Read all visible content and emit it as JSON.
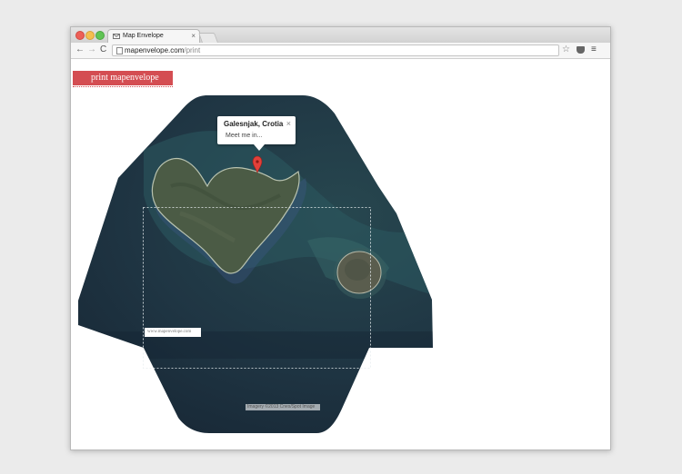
{
  "browser": {
    "tab_title": "Map Envelope",
    "tab_close": "×",
    "url_domain": "mapenvelope.com",
    "url_path": "/print",
    "nav_back": "←",
    "nav_forward": "→",
    "nav_reload": "C",
    "star": "☆",
    "menu": "≡"
  },
  "page": {
    "print_button_label": "print mapenvelope",
    "stamp_text": "www.mapenvelope.com",
    "imagery_credit": "Imagery ©2013 Cnes/Spot Image",
    "map": {
      "infowindow_title": "Galesnjak, Crotia",
      "infowindow_body": "Meet me in...",
      "infowindow_close": "×",
      "pin_color": "#e2403a"
    }
  },
  "colors": {
    "accent": "#d44d52",
    "sea_dark": "#1d3040",
    "sea_shallow": "#2b5b62",
    "island": "#4a5a43"
  }
}
